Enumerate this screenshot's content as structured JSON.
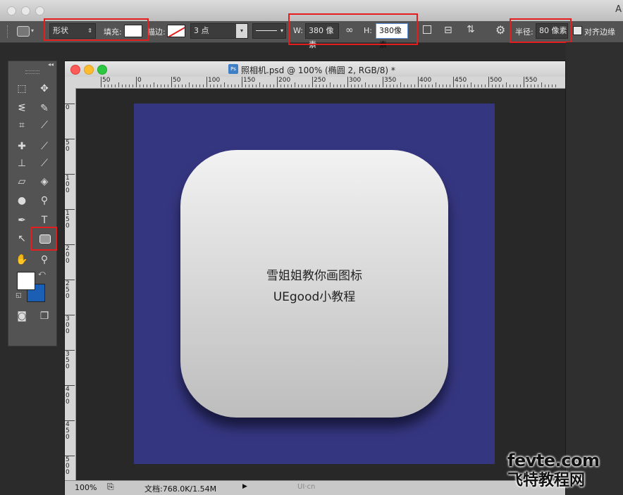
{
  "mac": {
    "app_letter": "A"
  },
  "options": {
    "mode_value": "形状",
    "fill_label": "填充:",
    "stroke_label": "描边:",
    "stroke_width": "3 点",
    "width_label": "W:",
    "width_value": "380 像素",
    "height_label": "H:",
    "height_value": "380像素",
    "radius_label": "半径:",
    "radius_value": "80 像素",
    "align_edges_label": "对齐边缘"
  },
  "document": {
    "title": "照相机.psd @ 100% (椭圆 2, RGB/8) *",
    "zoom": "100%",
    "doc_size": "文档:768.0K/1.54M",
    "hruler_labels": [
      "50",
      "0",
      "50",
      "100",
      "150",
      "200",
      "250",
      "300",
      "350",
      "400",
      "450",
      "500",
      "550"
    ],
    "vruler_labels": [
      "0",
      "5 0",
      "1 0 0",
      "1 5 0",
      "2 0 0",
      "2 5 0",
      "3 0 0",
      "3 5 0",
      "4 0 0",
      "4 5 0",
      "5 0 0"
    ],
    "icon_line1": "雪姐姐教你画图标",
    "icon_line2": "UEgood小教程",
    "ui_logo": "UI·cn"
  },
  "colors": {
    "canvas": "#353680",
    "foreground": "#ffffff",
    "background": "#1a5fb4",
    "highlight": "#e41e1e"
  },
  "watermark": {
    "line1": "fevte.com",
    "line2": "飞特教程网"
  }
}
